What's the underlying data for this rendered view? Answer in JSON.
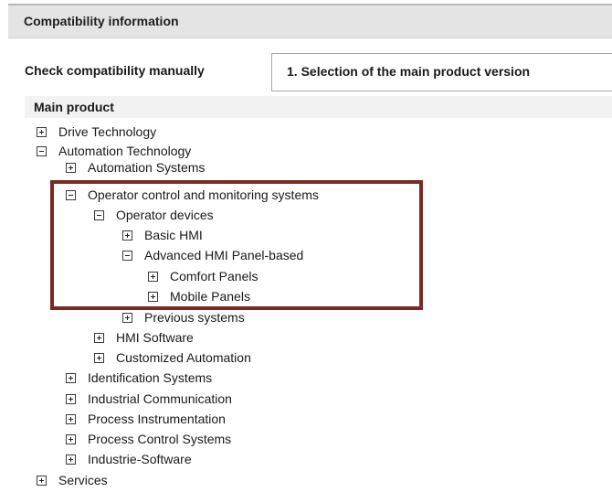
{
  "header": {
    "title": "Compatibility information"
  },
  "check": {
    "label": "Check compatibility manually",
    "step_label": "1. Selection of the main product version"
  },
  "tree": {
    "heading": "Main product",
    "nodes": [
      {
        "label": "Drive Technology",
        "state": "collapsed",
        "level": 0
      },
      {
        "label": "Automation Technology",
        "state": "expanded",
        "level": 0
      },
      {
        "label": "Automation Systems",
        "state": "collapsed",
        "level": 1
      },
      {
        "label": "Operator control and monitoring systems",
        "state": "expanded",
        "level": 1
      },
      {
        "label": "Operator devices",
        "state": "expanded",
        "level": 2
      },
      {
        "label": "Basic HMI",
        "state": "collapsed",
        "level": 3
      },
      {
        "label": "Advanced HMI Panel-based",
        "state": "expanded",
        "level": 3
      },
      {
        "label": "Comfort Panels",
        "state": "collapsed",
        "level": 4
      },
      {
        "label": "Mobile Panels",
        "state": "collapsed",
        "level": 4
      },
      {
        "label": "Previous systems",
        "state": "collapsed",
        "level": 3
      },
      {
        "label": "HMI Software",
        "state": "collapsed",
        "level": 2
      },
      {
        "label": "Customized Automation",
        "state": "collapsed",
        "level": 2
      },
      {
        "label": "Identification Systems",
        "state": "collapsed",
        "level": 1
      },
      {
        "label": "Industrial Communication",
        "state": "collapsed",
        "level": 1
      },
      {
        "label": "Process Instrumentation",
        "state": "collapsed",
        "level": 1
      },
      {
        "label": "Process Control Systems",
        "state": "collapsed",
        "level": 1
      },
      {
        "label": "Industrie-Software",
        "state": "collapsed",
        "level": 1
      },
      {
        "label": "Services",
        "state": "collapsed",
        "level": 0
      }
    ]
  },
  "highlight_color": "#7a2a22"
}
